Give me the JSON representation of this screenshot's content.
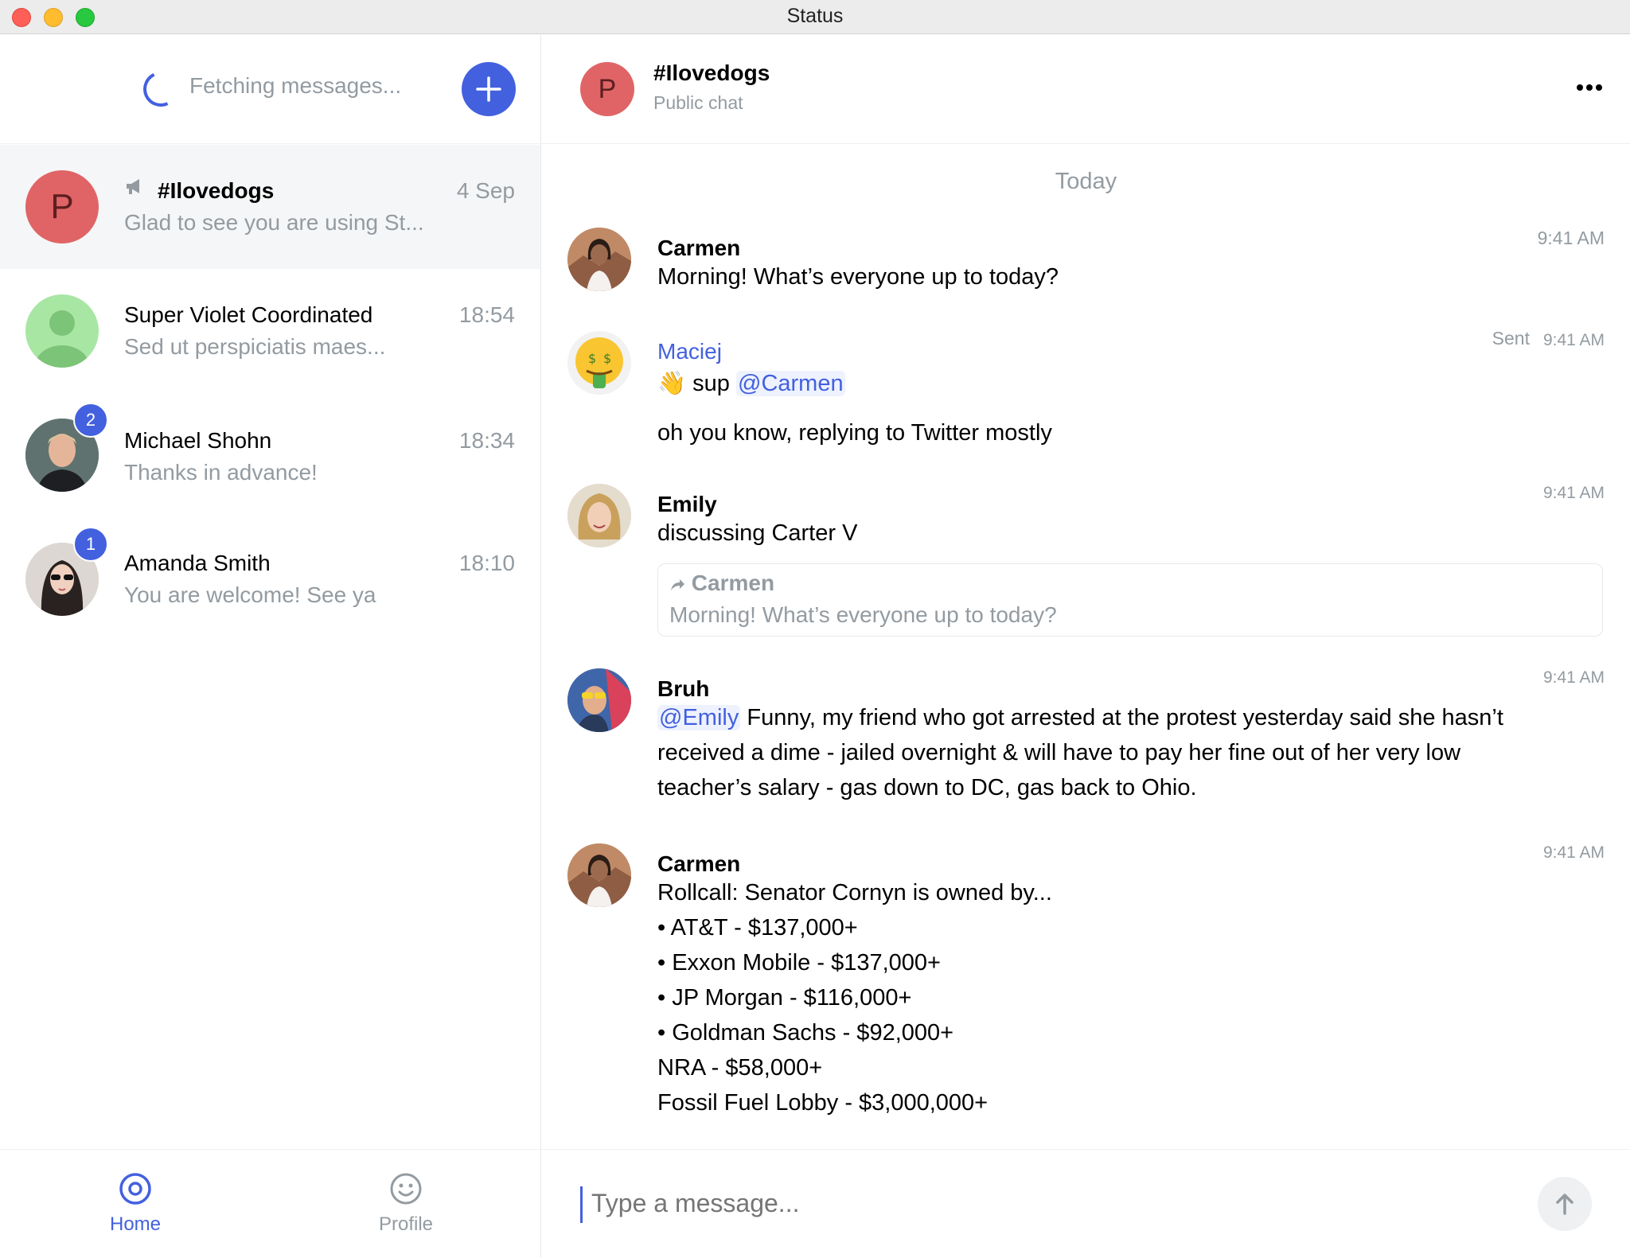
{
  "window": {
    "title": "Status"
  },
  "sidebar": {
    "status_text": "Fetching messages...",
    "chats": [
      {
        "name": "#Ilovedogs",
        "preview": "Glad to see you are using St...",
        "time": "4 Sep",
        "avatar_letter": "P",
        "public": true
      },
      {
        "name": "Super Violet Coordinated",
        "preview": "Sed ut perspiciatis maes...",
        "time": "18:54"
      },
      {
        "name": "Michael Shohn",
        "preview": "Thanks in advance!",
        "time": "18:34",
        "unread": "2"
      },
      {
        "name": "Amanda Smith",
        "preview": "You are welcome! See ya",
        "time": "18:10",
        "unread": "1"
      }
    ],
    "nav": [
      {
        "label": "Home"
      },
      {
        "label": "Profile"
      }
    ]
  },
  "header": {
    "avatar_letter": "P",
    "title": "#Ilovedogs",
    "subtitle": "Public chat"
  },
  "messages": {
    "day_separator": "Today",
    "items": [
      {
        "author": "Carmen",
        "time": "9:41 AM",
        "text": "Morning! What’s everyone up to today?"
      },
      {
        "author": "Maciej",
        "time": "9:41 AM",
        "sent_label": "Sent",
        "emoji": "👋",
        "text_before": "sup",
        "mention": "@Carmen",
        "text2": "oh you know, replying to Twitter mostly"
      },
      {
        "author": "Emily",
        "time": "9:41 AM",
        "text": "discussing Carter V",
        "quote_author": "Carmen",
        "quote_text": "Morning! What’s everyone up to today?"
      },
      {
        "author": "Bruh",
        "time": "9:41 AM",
        "mention": "@Emily",
        "line1": " Funny, my friend who got arrested at the protest yesterday said she hasn’t",
        "line2": "received a dime - jailed overnight & will have to pay her fine out of her very low",
        "line3": "teacher’s salary - gas down to DC, gas back to Ohio."
      },
      {
        "author": "Carmen",
        "time": "9:41 AM",
        "lines": [
          "Rollcall: Senator Cornyn is owned by...",
          "• AT&T - $137,000+",
          "• Exxon Mobile - $137,000+",
          "• JP Morgan - $116,000+",
          "• Goldman Sachs - $92,000+",
          "NRA - $58,000+",
          "Fossil Fuel Lobby - $3,000,000+"
        ]
      }
    ]
  },
  "composer": {
    "placeholder": "Type a message..."
  },
  "colors": {
    "accent": "#4360df",
    "muted": "#939ba1",
    "avatar_red": "#e06466"
  }
}
